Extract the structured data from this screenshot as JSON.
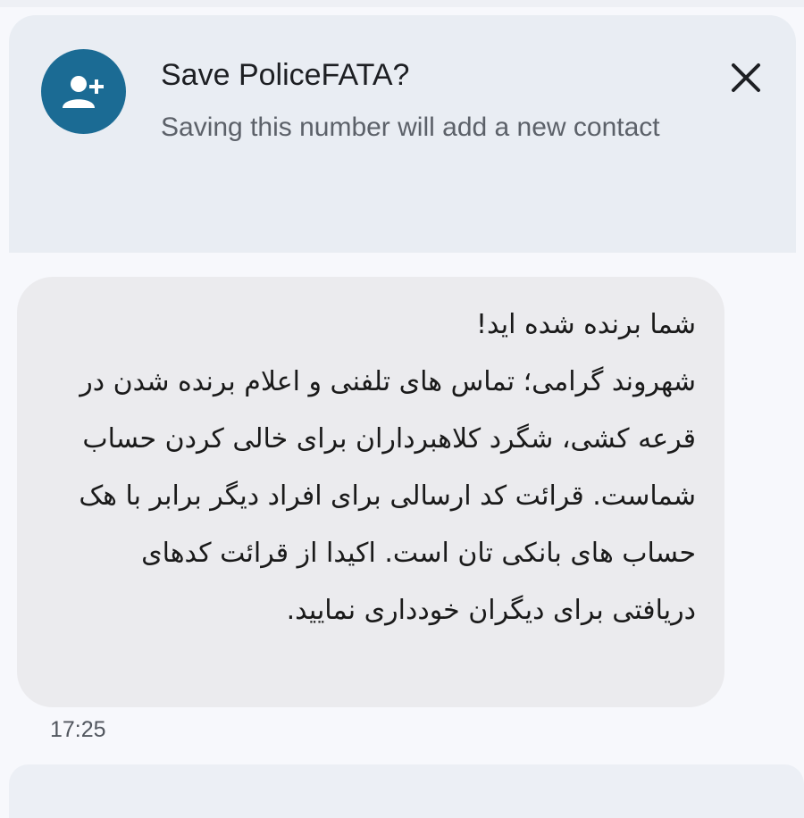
{
  "save_contact_card": {
    "title": "Save PoliceFATA?",
    "subtitle": "Saving this number will add a new contact",
    "avatar_icon": "add-person-icon",
    "close_icon": "close-icon",
    "accent_color": "#1b6b94"
  },
  "message": {
    "text": "شما برنده شده اید!\nشهروند گرامی؛ تماس های تلفنی و اعلام برنده شدن در قرعه کشی، شگرد کلاهبرداران برای خالی کردن حساب شماست. قرائت کد ارسالی برای افراد دیگر برابر با هک حساب های بانکی تان است. اکیدا از قرائت کدهای دریافتی برای دیگران خودداری نمایید.",
    "timestamp": "17:25"
  }
}
